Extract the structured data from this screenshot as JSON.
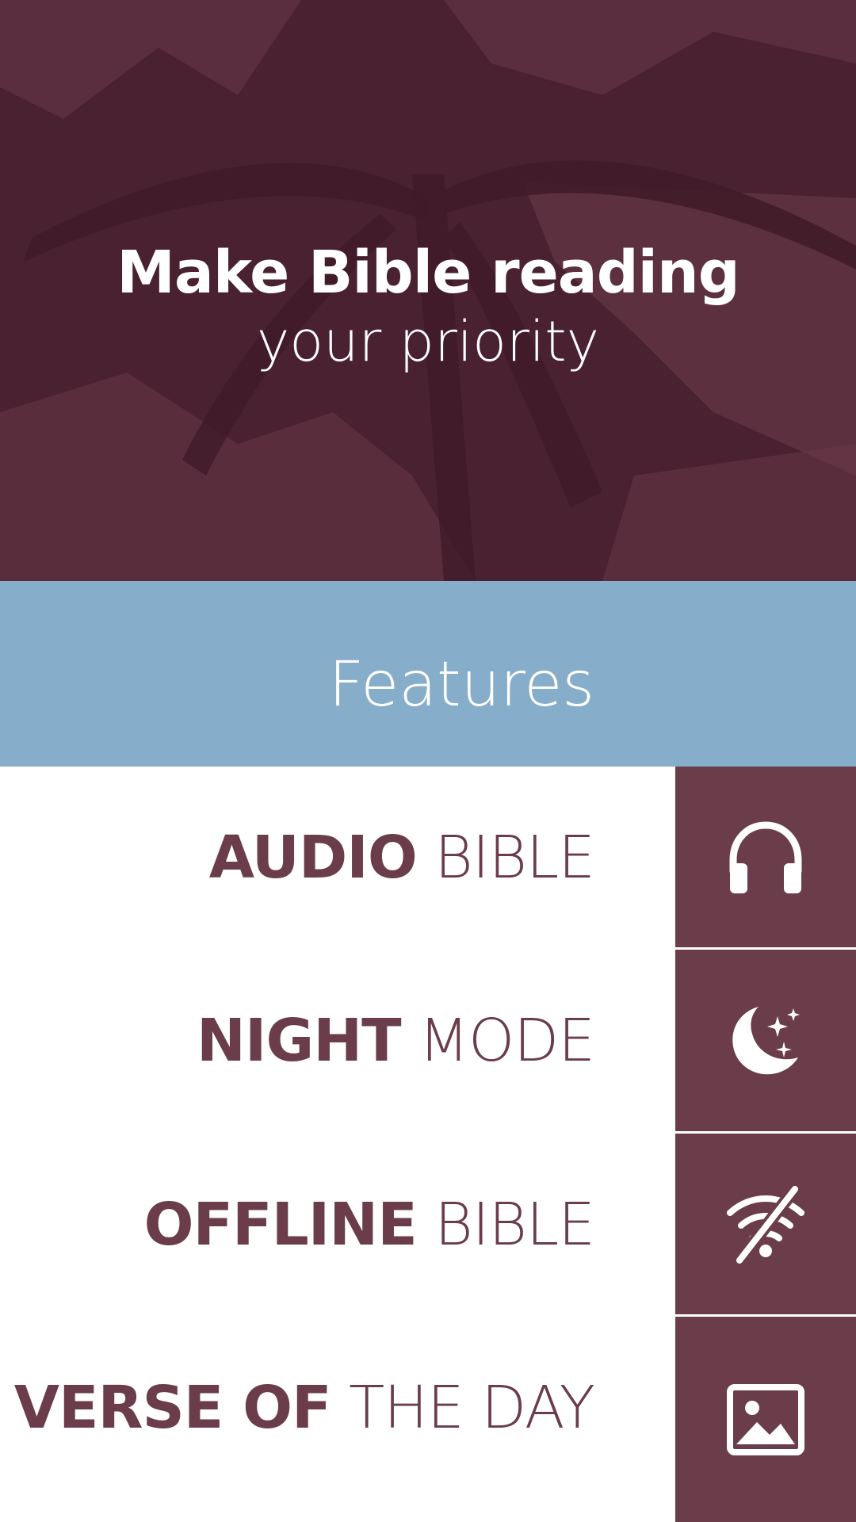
{
  "hero": {
    "title": "Make Bible reading",
    "subtitle": "your priority"
  },
  "features": {
    "heading": "Features",
    "items": [
      {
        "bold": "AUDIO",
        "light": "BIBLE",
        "icon": "headphones-icon"
      },
      {
        "bold": "NIGHT",
        "light": "MODE",
        "icon": "moon-stars-icon"
      },
      {
        "bold": "OFFLINE",
        "light": "BIBLE",
        "icon": "wifi-off-icon"
      },
      {
        "bold": "VERSE OF",
        "light": "THE DAY",
        "icon": "image-icon"
      }
    ]
  },
  "colors": {
    "hero_bg": "#4a2131",
    "band_bg": "#86adca",
    "accent": "#6b3d4a",
    "text_light": "#ffffff"
  }
}
